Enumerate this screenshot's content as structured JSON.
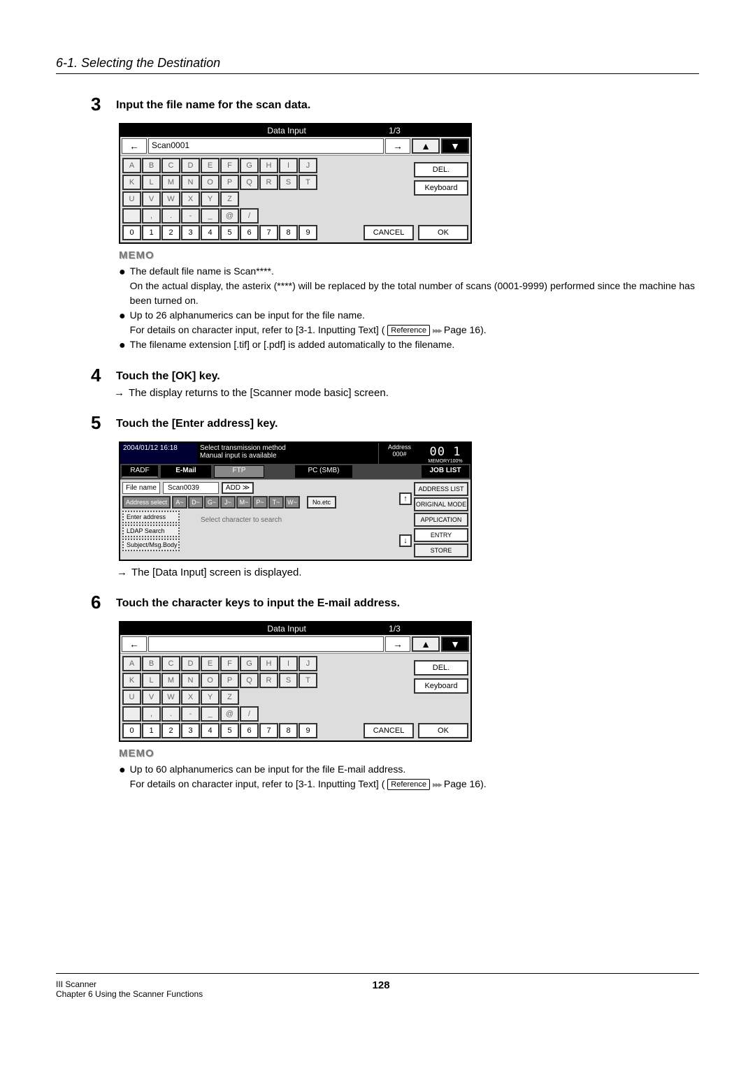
{
  "header": "6-1. Selecting the Destination",
  "steps": {
    "s3": {
      "num": "3",
      "title": "Input the file name for the scan data."
    },
    "s4": {
      "num": "4",
      "title": "Touch the [OK] key.",
      "text_prefix": "→ ",
      "text": "The display returns to the [Scanner mode basic] screen."
    },
    "s5": {
      "num": "5",
      "title": "Touch the [Enter address] key.",
      "text_prefix": "→ ",
      "text": "The [Data Input] screen is displayed."
    },
    "s6": {
      "num": "6",
      "title": "Touch the character keys to input the E-mail address."
    }
  },
  "di": {
    "title": "Data Input",
    "page": "1/3",
    "input_value": "Scan0001",
    "arrow_left": "←",
    "arrow_right": "→",
    "home_icon": "⌂",
    "caps_icon": "⇧",
    "rows": {
      "r1": [
        "A",
        "B",
        "C",
        "D",
        "E",
        "F",
        "G",
        "H",
        "I",
        "J"
      ],
      "r2": [
        "K",
        "L",
        "M",
        "N",
        "O",
        "P",
        "Q",
        "R",
        "S",
        "T"
      ],
      "r3": [
        "U",
        "V",
        "W",
        "X",
        "Y",
        "Z"
      ],
      "r4": [
        " ",
        ",",
        ".",
        "-",
        "_",
        "@",
        "/"
      ],
      "r5": [
        "0",
        "1",
        "2",
        "3",
        "4",
        "5",
        "6",
        "7",
        "8",
        "9"
      ]
    },
    "del": "DEL.",
    "keyboard": "Keyboard",
    "cancel": "CANCEL",
    "ok": "OK"
  },
  "memo": {
    "label": "MEMO",
    "m3": {
      "b1": "The default file name is Scan****.",
      "b1b": "On the actual display, the asterix (****) will be replaced by the total number of scans (0001-9999) performed since the machine has been turned on.",
      "b2": "Up to 26 alphanumerics can be input for the file name.",
      "b2b_pre": "For details on character input, refer to [3-1. Inputting Text] (",
      "ref": "Reference",
      "b2b_post": " Page 16).",
      "b3": "The filename extension [.tif] or [.pdf] is added automatically to the filename."
    },
    "m6": {
      "b1": "Up to 60 alphanumerics can be input for the file E-mail address.",
      "b1b_pre": "For details on character input, refer to [3-1. Inputting Text] (",
      "ref": "Reference",
      "b1b_post": " Page 16)."
    }
  },
  "scanner": {
    "datetime": "2004/01/12 16:18",
    "msg1": "Select transmission method",
    "msg2": "Manual input is available",
    "addr_label": "Address",
    "addr_val": "000#",
    "segments": "00 1",
    "memory": "MEMORY100%",
    "radf": "RADF",
    "email": "E-Mail",
    "ftp": "FTP",
    "pcsmb": "PC (SMB)",
    "joblist": "JOB LIST",
    "file_name_label": "File name",
    "file_name_value": "Scan0039",
    "add": "ADD ≫",
    "address_select": "Address select",
    "letters": [
      "A~",
      "D~",
      "G~",
      "J~",
      "M~",
      "P~",
      "T~",
      "W~"
    ],
    "noetc": "No.etc",
    "enter_address": "Enter address",
    "ldap": "LDAP Search",
    "subject": "Subject/Msg.Body",
    "search_text": "Select character to search",
    "up": "↑",
    "down": "↓",
    "right": {
      "address_list": "ADDRESS LIST",
      "original_mode": "ORIGINAL MODE",
      "application": "APPLICATION",
      "entry": "ENTRY",
      "store": "STORE"
    }
  },
  "ref_arrows": "▸▸▸",
  "footer": {
    "left1": "III Scanner",
    "left2": "Chapter 6 Using the Scanner Functions",
    "center": "128"
  }
}
